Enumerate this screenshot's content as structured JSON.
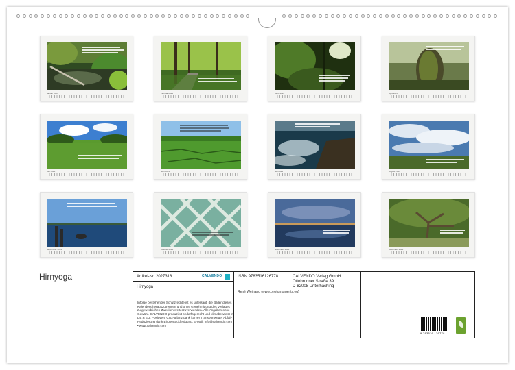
{
  "calendar": {
    "title": "Hirnyoga",
    "months": [
      {
        "name": "Januar 2024",
        "scene": "river-jungle"
      },
      {
        "name": "Februar 2024",
        "scene": "forest-path"
      },
      {
        "name": "März 2024",
        "scene": "sun-forest"
      },
      {
        "name": "April 2024",
        "scene": "mossy-trunk"
      },
      {
        "name": "Mai 2024",
        "scene": "meadow-sky"
      },
      {
        "name": "Juni 2024",
        "scene": "green-fields"
      },
      {
        "name": "Juli 2024",
        "scene": "sea-rocks"
      },
      {
        "name": "August 2024",
        "scene": "cloud-sky"
      },
      {
        "name": "September 2024",
        "scene": "harbour"
      },
      {
        "name": "Oktober 2024",
        "scene": "lattice"
      },
      {
        "name": "November 2024",
        "scene": "dusk-lake"
      },
      {
        "name": "Dezember 2024",
        "scene": "old-tree"
      }
    ]
  },
  "info": {
    "artikel": "Artikel-Nr. 2027318",
    "logo": "CALVENDO",
    "title": "Hirnyoga",
    "notice": "Infolge bestehender Schutzrechte ist es untersagt, die Bilder dieses Kalenders herauszutrennen und ohne Genehmigung des Verlages zu gewerblichen Zwecken weiterzuverwenden. Alle Angaben ohne Gewähr. CALVENDO produziert bedarfsgerecht und klimabewusst in DE & EU. Positivere CO2-Bilanz dank kurzer Transportwege. Abfall-Reduzierung dank Einzelstückfertigung. E-Mail: info@calvendo.com • www.calvendo.com",
    "isbn": "ISBN 9783516126778",
    "author": "René Weinand (www.photomoments.eu)",
    "publisher": "CALVENDO Verlag GmbH",
    "street": "Ottobrunner Straße 39",
    "city": "D-82008 Unterhaching",
    "barcode_number": "9 783516 126778"
  },
  "colors": {
    "border": "#222222",
    "logo_blue": "#1a7fa0",
    "fsc_green": "#6ca22f"
  }
}
